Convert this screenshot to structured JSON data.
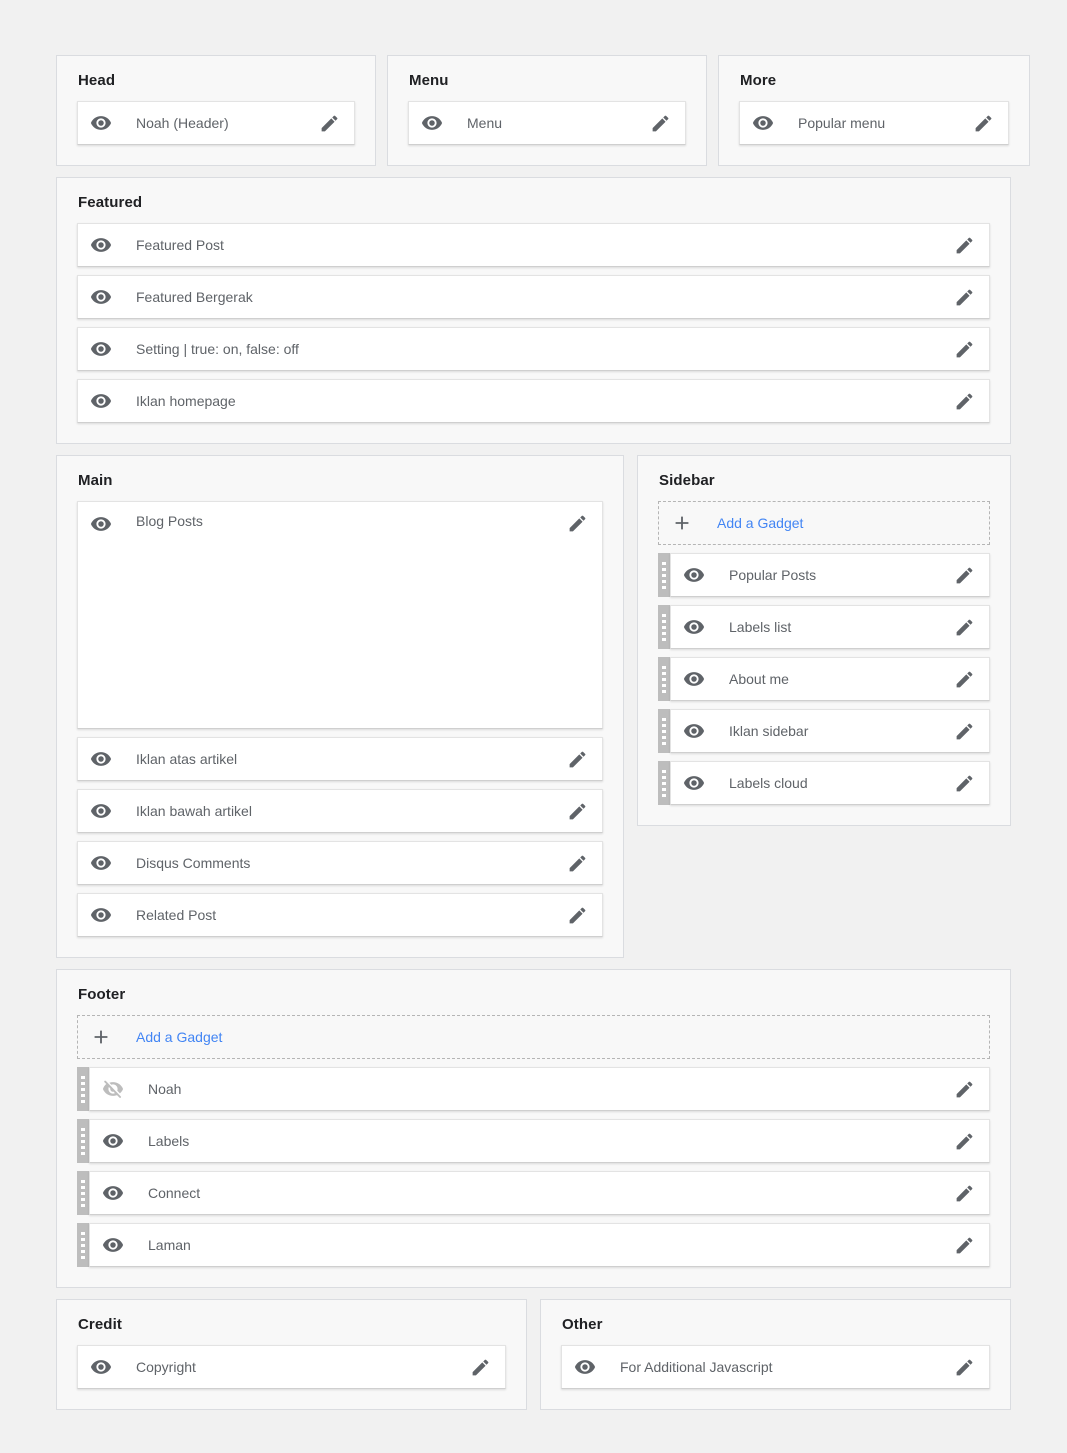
{
  "icons": {
    "eye_visible": "eye-icon",
    "eye_hidden": "eye-off-icon",
    "edit": "pencil-icon",
    "add": "plus-icon",
    "drag": "drag-handle-icon"
  },
  "colors": {
    "page_background": "#f1f1f1",
    "panel_background": "#f8f8f8",
    "panel_border": "#dadce0",
    "gadget_background": "#ffffff",
    "link_blue": "#4285f4",
    "label_text": "#5f6368",
    "title_text": "#202124",
    "icon_gray": "#5f6368",
    "drag_handle": "#bdbdbd"
  },
  "add_gadget_label": "Add a Gadget",
  "sections": {
    "head": {
      "title": "Head",
      "gadgets": [
        {
          "label": "Noah (Header)",
          "visible": true,
          "draggable": false
        }
      ]
    },
    "menu": {
      "title": "Menu",
      "gadgets": [
        {
          "label": "Menu",
          "visible": true,
          "draggable": false
        }
      ]
    },
    "more": {
      "title": "More",
      "gadgets": [
        {
          "label": "Popular menu",
          "visible": true,
          "draggable": false
        }
      ]
    },
    "featured": {
      "title": "Featured",
      "gadgets": [
        {
          "label": "Featured Post",
          "visible": true,
          "draggable": false
        },
        {
          "label": "Featured Bergerak",
          "visible": true,
          "draggable": false
        },
        {
          "label": "Setting | true: on, false: off",
          "visible": true,
          "draggable": false
        },
        {
          "label": "Iklan homepage",
          "visible": true,
          "draggable": false
        }
      ]
    },
    "main": {
      "title": "Main",
      "gadgets": [
        {
          "label": "Blog Posts",
          "visible": true,
          "draggable": false,
          "tall": true
        },
        {
          "label": "Iklan atas artikel",
          "visible": true,
          "draggable": false
        },
        {
          "label": "Iklan bawah artikel",
          "visible": true,
          "draggable": false
        },
        {
          "label": "Disqus Comments",
          "visible": true,
          "draggable": false
        },
        {
          "label": "Related Post",
          "visible": true,
          "draggable": false
        }
      ]
    },
    "sidebar": {
      "title": "Sidebar",
      "has_add_gadget": true,
      "gadgets": [
        {
          "label": "Popular Posts",
          "visible": true,
          "draggable": true
        },
        {
          "label": "Labels list",
          "visible": true,
          "draggable": true
        },
        {
          "label": "About me",
          "visible": true,
          "draggable": true
        },
        {
          "label": "Iklan sidebar",
          "visible": true,
          "draggable": true
        },
        {
          "label": "Labels cloud",
          "visible": true,
          "draggable": true
        }
      ]
    },
    "footer": {
      "title": "Footer",
      "has_add_gadget": true,
      "gadgets": [
        {
          "label": "Noah",
          "visible": false,
          "draggable": true
        },
        {
          "label": "Labels",
          "visible": true,
          "draggable": true
        },
        {
          "label": "Connect",
          "visible": true,
          "draggable": true
        },
        {
          "label": "Laman",
          "visible": true,
          "draggable": true
        }
      ]
    },
    "credit": {
      "title": "Credit",
      "gadgets": [
        {
          "label": "Copyright",
          "visible": true,
          "draggable": false
        }
      ]
    },
    "other": {
      "title": "Other",
      "gadgets": [
        {
          "label": "For Additional Javascript",
          "visible": true,
          "draggable": false
        }
      ]
    }
  }
}
